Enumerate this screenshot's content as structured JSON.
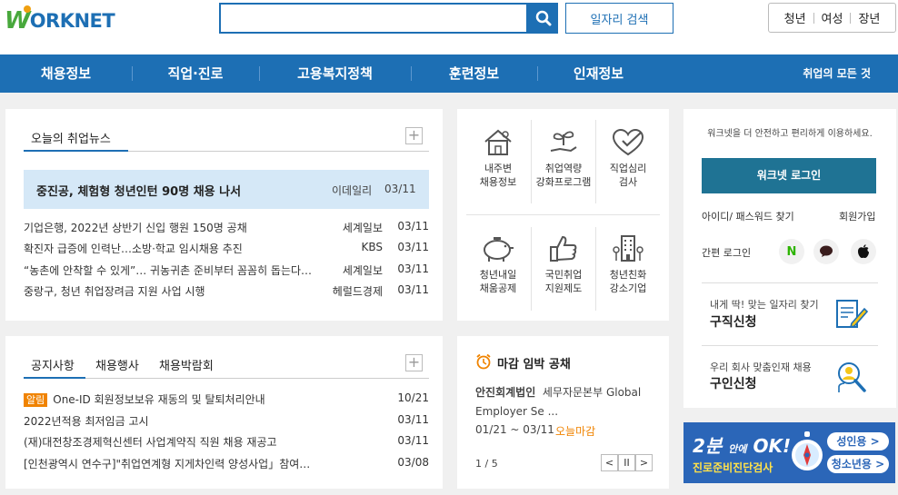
{
  "header": {
    "logo_w": "W",
    "logo_text": "ORKNET",
    "search_placeholder": "",
    "job_search_label": "일자리 검색",
    "target_links": [
      "청년",
      "여성",
      "장년"
    ]
  },
  "nav": {
    "items": [
      "채용정보",
      "직업·진로",
      "고용복지정책",
      "훈련정보",
      "인재정보"
    ],
    "all_label": "취업의 모든 것"
  },
  "news": {
    "tab": "오늘의 취업뉴스",
    "plus": "+",
    "headline": {
      "title": "중진공, 체험형 청년인턴 90명 채용 나서",
      "source": "이데일리",
      "date": "03/11"
    },
    "items": [
      {
        "title": "기업은행, 2022년 상반기 신입 행원 150명 공채",
        "source": "세계일보",
        "date": "03/11"
      },
      {
        "title": "확진자 급증에 인력난…소방·학교 임시채용 추진",
        "source": "KBS",
        "date": "03/11"
      },
      {
        "title": "“농촌에 안착할 수 있게”… 귀농귀촌 준비부터 꼼꼼히 돕는다…",
        "source": "세계일보",
        "date": "03/11"
      },
      {
        "title": "중랑구, 청년 취업장려금 지원 사업 시행",
        "source": "헤럴드경제",
        "date": "03/11"
      }
    ]
  },
  "services": [
    {
      "icon": "house-icon",
      "label1": "내주변",
      "label2": "채용정보"
    },
    {
      "icon": "plant-hand-icon",
      "label1": "취업역량",
      "label2": "강화프로그램"
    },
    {
      "icon": "heart-check-icon",
      "label1": "직업심리",
      "label2": "검사"
    },
    {
      "icon": "piggy-bank-icon",
      "label1": "청년내일",
      "label2": "채움공제"
    },
    {
      "icon": "thumbs-up-icon",
      "label1": "국민취업",
      "label2": "지원제도"
    },
    {
      "icon": "building-icon",
      "label1": "청년친화",
      "label2": "강소기업"
    }
  ],
  "login": {
    "message": "워크넷을 더 안전하고 편리하게 이용하세요.",
    "button": "워크넷 로그인",
    "find": "아이디/ 패스워드 찾기",
    "join": "회원가입",
    "easy_login": "간편 로그인",
    "sns": [
      "N",
      "💬",
      ""
    ],
    "job_seek_sub": "내게 딱! 맞는 일자리 찾기",
    "job_seek_main": "구직신청",
    "recruit_sub": "우리 회사 맞춤인재 채용",
    "recruit_main": "구인신청"
  },
  "notice": {
    "tabs": [
      "공지사항",
      "채용행사",
      "채용박람회"
    ],
    "plus": "+",
    "items": [
      {
        "badge": "알림",
        "title": "One-ID 회원정보보유 재동의 및 탈퇴처리안내",
        "date": "10/21"
      },
      {
        "badge": "",
        "title": "2022년적용 최저임금 고시",
        "date": "03/11"
      },
      {
        "badge": "",
        "title": "(재)대전창조경제혁신센터 사업계약직 직원 채용 재공고",
        "date": "03/11"
      },
      {
        "badge": "",
        "title": "[인천광역시 연수구]\"취업연계형 지게차인력 양성사업」참여…",
        "date": "03/08"
      }
    ]
  },
  "deadline": {
    "title": "마감 임박 공채",
    "company": "안진회계법인",
    "desc": "세무자문본부 Global Employer Se ...",
    "date": "01/21 ~ 03/11",
    "tag": "오늘마감",
    "page": "1 / 5",
    "prev": "<",
    "pause": "II",
    "next": ">"
  },
  "banner": {
    "line1": "2분",
    "line1b": "안에",
    "line1c": "OK!",
    "line2": "진로준비진단검사",
    "adult": "성인용 >",
    "youth": "청소년용 >"
  },
  "colors": {
    "primary": "#1d6fb4",
    "green": "#48a83c",
    "orange": "#f08300",
    "login": "#1f7394"
  }
}
